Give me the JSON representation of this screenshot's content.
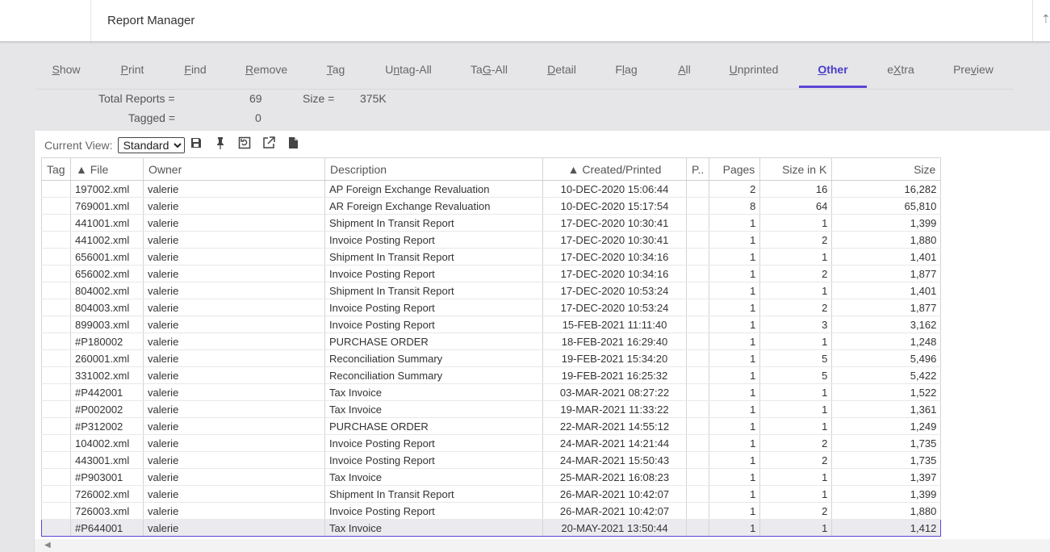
{
  "app": {
    "title": "Report Manager",
    "corner_icon": "sort-up-icon"
  },
  "tabs": [
    {
      "pre": "",
      "ul": "S",
      "post": "how"
    },
    {
      "pre": "",
      "ul": "P",
      "post": "rint"
    },
    {
      "pre": "",
      "ul": "F",
      "post": "ind"
    },
    {
      "pre": "",
      "ul": "R",
      "post": "emove"
    },
    {
      "pre": "",
      "ul": "T",
      "post": "ag"
    },
    {
      "pre": "U",
      "ul": "n",
      "post": "tag-All"
    },
    {
      "pre": "Ta",
      "ul": "G",
      "post": "-All"
    },
    {
      "pre": "",
      "ul": "D",
      "post": "etail"
    },
    {
      "pre": "F",
      "ul": "l",
      "post": "ag"
    },
    {
      "pre": "",
      "ul": "A",
      "post": "ll"
    },
    {
      "pre": "",
      "ul": "U",
      "post": "nprinted"
    },
    {
      "pre": "",
      "ul": "O",
      "post": "ther"
    },
    {
      "pre": "e",
      "ul": "X",
      "post": "tra"
    },
    {
      "pre": "Pre",
      "ul": "v",
      "post": "iew"
    }
  ],
  "active_tab": "Other",
  "stats": {
    "total_label": "Total Reports =",
    "total_value": "69",
    "size_label": "Size =",
    "size_value": "375K",
    "tagged_label": "Tagged =",
    "tagged_value": "0"
  },
  "toolbar": {
    "view_label": "Current View:",
    "view_value": "Standard",
    "icons": [
      "save-icon",
      "pin-icon",
      "restore-icon",
      "export-icon",
      "document-icon"
    ]
  },
  "columns": [
    "Tag",
    "▲ File",
    "Owner",
    "Description",
    "▲ Created/Printed",
    "P..",
    "Pages",
    "Size in K",
    "Size"
  ],
  "rows": [
    [
      "",
      "197002.xml",
      "valerie",
      "AP Foreign Exchange Revaluation",
      "10-DEC-2020 15:06:44",
      "",
      "2",
      "16",
      "16,282"
    ],
    [
      "",
      "769001.xml",
      "valerie",
      "AR Foreign Exchange Revaluation",
      "10-DEC-2020 15:17:54",
      "",
      "8",
      "64",
      "65,810"
    ],
    [
      "",
      "441001.xml",
      "valerie",
      "Shipment In Transit Report",
      "17-DEC-2020 10:30:41",
      "",
      "1",
      "1",
      "1,399"
    ],
    [
      "",
      "441002.xml",
      "valerie",
      "Invoice Posting Report",
      "17-DEC-2020 10:30:41",
      "",
      "1",
      "2",
      "1,880"
    ],
    [
      "",
      "656001.xml",
      "valerie",
      "Shipment In Transit Report",
      "17-DEC-2020 10:34:16",
      "",
      "1",
      "1",
      "1,401"
    ],
    [
      "",
      "656002.xml",
      "valerie",
      "Invoice Posting Report",
      "17-DEC-2020 10:34:16",
      "",
      "1",
      "2",
      "1,877"
    ],
    [
      "",
      "804002.xml",
      "valerie",
      "Shipment In Transit Report",
      "17-DEC-2020 10:53:24",
      "",
      "1",
      "1",
      "1,401"
    ],
    [
      "",
      "804003.xml",
      "valerie",
      "Invoice Posting Report",
      "17-DEC-2020 10:53:24",
      "",
      "1",
      "2",
      "1,877"
    ],
    [
      "",
      "899003.xml",
      "valerie",
      "Invoice Posting Report",
      "15-FEB-2021 11:11:40",
      "",
      "1",
      "3",
      "3,162"
    ],
    [
      "",
      "#P180002",
      "valerie",
      "PURCHASE ORDER",
      "18-FEB-2021 16:29:40",
      "",
      "1",
      "1",
      "1,248"
    ],
    [
      "",
      "260001.xml",
      "valerie",
      "Reconciliation Summary",
      "19-FEB-2021 15:34:20",
      "",
      "1",
      "5",
      "5,496"
    ],
    [
      "",
      "331002.xml",
      "valerie",
      "Reconciliation Summary",
      "19-FEB-2021 16:25:32",
      "",
      "1",
      "5",
      "5,422"
    ],
    [
      "",
      "#P442001",
      "valerie",
      "Tax Invoice",
      "03-MAR-2021 08:27:22",
      "",
      "1",
      "1",
      "1,522"
    ],
    [
      "",
      "#P002002",
      "valerie",
      "Tax Invoice",
      "19-MAR-2021 11:33:22",
      "",
      "1",
      "1",
      "1,361"
    ],
    [
      "",
      "#P312002",
      "valerie",
      "PURCHASE ORDER",
      "22-MAR-2021 14:55:12",
      "",
      "1",
      "1",
      "1,249"
    ],
    [
      "",
      "104002.xml",
      "valerie",
      "Invoice Posting Report",
      "24-MAR-2021 14:21:44",
      "",
      "1",
      "2",
      "1,735"
    ],
    [
      "",
      "443001.xml",
      "valerie",
      "Invoice Posting Report",
      "24-MAR-2021 15:50:43",
      "",
      "1",
      "2",
      "1,735"
    ],
    [
      "",
      "#P903001",
      "valerie",
      "Tax Invoice",
      "25-MAR-2021 16:08:23",
      "",
      "1",
      "1",
      "1,397"
    ],
    [
      "",
      "726002.xml",
      "valerie",
      "Shipment In Transit Report",
      "26-MAR-2021 10:42:07",
      "",
      "1",
      "1",
      "1,399"
    ],
    [
      "",
      "726003.xml",
      "valerie",
      "Invoice Posting Report",
      "26-MAR-2021 10:42:07",
      "",
      "1",
      "2",
      "1,880"
    ],
    [
      "",
      "#P644001",
      "valerie",
      "Tax Invoice",
      "20-MAY-2021 13:50:44",
      "",
      "1",
      "1",
      "1,412"
    ]
  ],
  "selected_row": 20,
  "colors": {
    "accent": "#5b45d6",
    "background": "#e6e6e9"
  }
}
